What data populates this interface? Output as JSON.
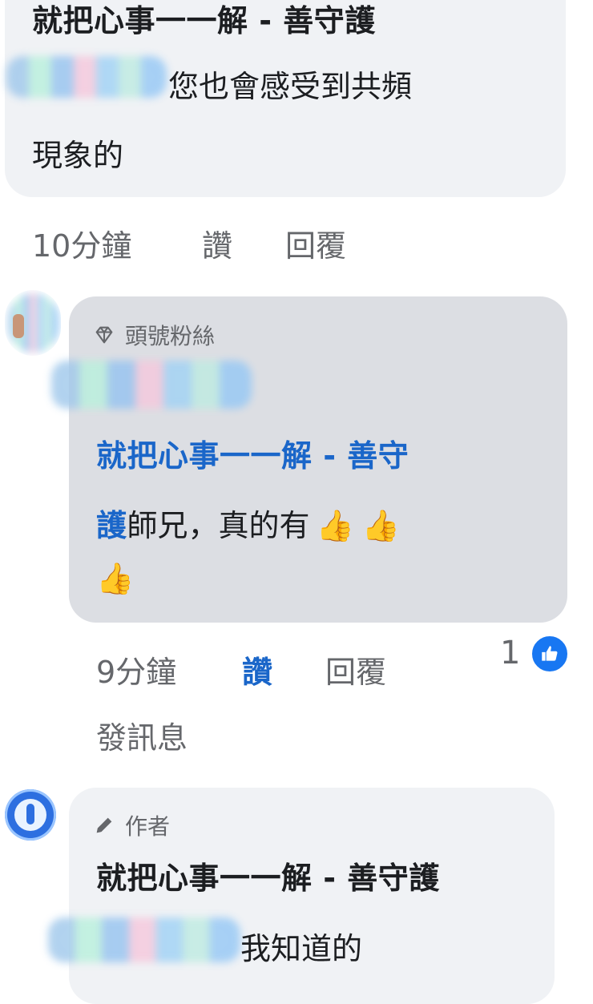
{
  "comments": [
    {
      "author_name": "就把心事一一解 - 善守護",
      "text": "您也會感受到共頻現象的",
      "text_line1": "您也會感受到共頻",
      "text_line2": "現象的",
      "meta": {
        "time": "10分鐘",
        "like": "讚",
        "reply": "回覆"
      }
    },
    {
      "badge": "頭號粉絲",
      "badge_icon": "diamond-icon",
      "mention_line1": "就把心事一一解 - 善守",
      "mention_line2": "護",
      "text": "師兄，真的有",
      "emoji": "👍",
      "meta": {
        "time": "9分鐘",
        "like": "讚",
        "reply": "回覆",
        "message": "發訊息"
      },
      "reaction": {
        "count": "1",
        "icon": "like-icon",
        "color": "#1877f2"
      },
      "liked_color": "#1a66c9"
    },
    {
      "badge": "作者",
      "badge_icon": "pencil-icon",
      "author_name": "就把心事一一解 - 善守護",
      "text": "我知道的"
    }
  ]
}
